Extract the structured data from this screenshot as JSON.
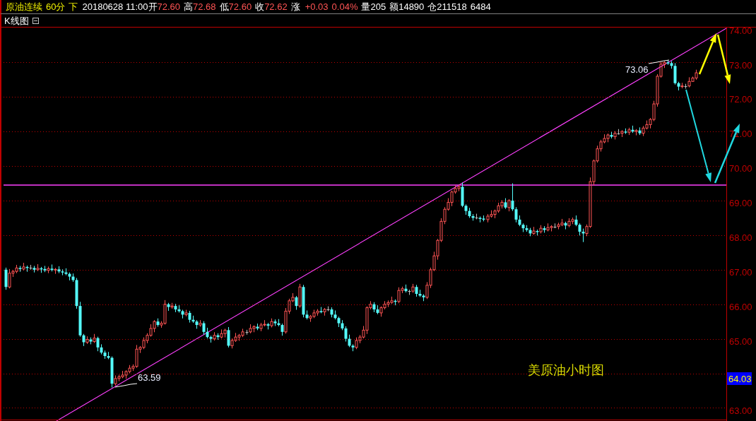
{
  "quote_bar": {
    "symbol": "原油连续",
    "period": "60分",
    "direction": "下",
    "datetime": "20180628 11:00",
    "prices": [
      {
        "label": "开",
        "value": "72.60"
      },
      {
        "label": "高",
        "value": "72.68"
      },
      {
        "label": "低",
        "value": "72.60"
      },
      {
        "label": "收",
        "value": "72.62"
      }
    ],
    "change": {
      "label": "涨",
      "value": "+0.03",
      "percent": "0.04%"
    },
    "stats": [
      "量205",
      "额14890",
      "仓211518",
      "6484"
    ]
  },
  "panel": {
    "title": "K线图"
  },
  "chart": {
    "chart_data": {
      "type": "candlestick",
      "grid": true,
      "ylim": [
        62.62,
        74.01
      ],
      "yticks": [
        {
          "value": 74,
          "label": "74.00"
        },
        {
          "value": 73,
          "label": "73.00"
        },
        {
          "value": 72,
          "label": "72.00"
        },
        {
          "value": 71,
          "label": "71.00"
        },
        {
          "value": 70,
          "label": "70.00"
        },
        {
          "value": 69,
          "label": "69.00"
        },
        {
          "value": 68,
          "label": "68.00"
        },
        {
          "value": 67,
          "label": "67.00"
        },
        {
          "value": 66,
          "label": "66.00"
        },
        {
          "value": 65,
          "label": "65.00"
        },
        {
          "value": 63,
          "label": "63.00"
        }
      ],
      "ref_lines": [
        {
          "axis": "y",
          "value": 69.45
        }
      ],
      "categories": [
        null,
        null,
        null,
        null,
        null,
        null,
        null,
        null,
        null,
        null,
        null,
        null,
        null,
        null,
        null,
        null,
        null,
        null,
        null,
        null,
        null,
        null,
        null,
        null,
        null,
        null,
        null,
        null,
        null,
        null,
        null,
        null,
        null,
        null,
        null,
        null,
        null,
        null,
        null,
        null,
        null,
        null,
        null,
        null,
        null,
        null,
        null,
        null,
        null,
        null,
        null,
        null,
        null,
        null,
        null,
        null,
        null,
        null,
        null,
        null,
        null,
        null,
        null,
        null,
        null,
        null,
        null,
        null,
        null,
        null,
        null,
        null,
        null,
        null,
        null,
        null,
        null,
        null,
        null,
        null,
        null,
        null,
        null,
        null,
        null,
        null,
        null,
        null,
        null,
        null,
        null,
        null,
        null,
        null,
        null,
        null,
        null,
        null,
        null,
        null,
        null,
        null,
        null,
        null,
        null,
        null,
        null,
        null,
        null,
        null,
        null,
        null,
        null,
        null,
        null,
        null,
        null,
        null,
        null,
        null,
        null,
        null,
        null,
        null,
        null,
        null,
        null,
        null,
        null,
        null,
        null,
        null,
        null,
        null,
        null,
        null,
        null,
        null,
        null,
        null,
        null,
        null,
        null,
        null,
        null,
        null,
        null,
        null,
        null,
        null,
        null,
        null,
        null,
        null,
        null,
        null,
        null,
        null,
        null,
        null,
        null,
        null,
        null,
        null,
        null,
        null,
        null,
        null,
        null,
        null,
        null,
        null,
        null,
        null,
        null,
        null,
        null,
        null,
        null,
        null,
        null,
        null,
        null,
        null,
        null,
        null,
        null,
        null,
        null,
        null,
        null,
        null,
        null,
        null,
        null,
        null,
        null,
        null,
        null,
        null,
        null,
        null,
        null,
        null
      ],
      "ohlc": [
        [
          67.0,
          67.06,
          66.42,
          66.5
        ],
        [
          66.5,
          67.02,
          66.46,
          66.9
        ],
        [
          66.9,
          66.99,
          66.79,
          66.95
        ],
        [
          66.95,
          67.14,
          66.9,
          67.05
        ],
        [
          67.05,
          67.11,
          66.94,
          67.02
        ],
        [
          67.02,
          67.2,
          66.98,
          67.08
        ],
        [
          67.08,
          67.12,
          66.94,
          67.05
        ],
        [
          67.05,
          67.14,
          67.0,
          67.05
        ],
        [
          67.05,
          67.11,
          66.92,
          67.0
        ],
        [
          67.0,
          67.16,
          66.96,
          67.04
        ],
        [
          67.04,
          67.08,
          66.91,
          67.02
        ],
        [
          67.02,
          67.11,
          66.93,
          66.98
        ],
        [
          66.98,
          67.09,
          66.9,
          67.03
        ],
        [
          67.03,
          67.15,
          66.95,
          66.99
        ],
        [
          66.99,
          67.05,
          66.88,
          67.01
        ],
        [
          67.01,
          67.1,
          66.9,
          66.95
        ],
        [
          66.95,
          67.01,
          66.84,
          66.92
        ],
        [
          66.92,
          67.04,
          66.84,
          66.88
        ],
        [
          66.88,
          66.92,
          66.69,
          66.8
        ],
        [
          66.8,
          66.89,
          66.65,
          66.7
        ],
        [
          66.7,
          66.76,
          65.87,
          65.95
        ],
        [
          65.95,
          66.07,
          65.06,
          65.1
        ],
        [
          65.1,
          65.14,
          64.79,
          64.9
        ],
        [
          64.9,
          65.07,
          64.85,
          64.98
        ],
        [
          64.98,
          65.04,
          64.84,
          64.92
        ],
        [
          64.92,
          65.14,
          64.88,
          65.02
        ],
        [
          65.02,
          65.06,
          64.64,
          64.75
        ],
        [
          64.75,
          64.84,
          64.55,
          64.6
        ],
        [
          64.6,
          64.66,
          64.42,
          64.5
        ],
        [
          64.5,
          64.62,
          64.41,
          64.45
        ],
        [
          64.45,
          64.49,
          63.59,
          63.7
        ],
        [
          63.7,
          63.94,
          63.65,
          63.85
        ],
        [
          63.85,
          63.96,
          63.77,
          63.9
        ],
        [
          63.9,
          64.07,
          63.86,
          63.95
        ],
        [
          63.95,
          64.09,
          63.84,
          64.05
        ],
        [
          64.05,
          64.24,
          64.0,
          64.15
        ],
        [
          64.15,
          64.26,
          64.07,
          64.2
        ],
        [
          64.2,
          64.82,
          64.16,
          64.7
        ],
        [
          64.7,
          64.79,
          64.59,
          64.75
        ],
        [
          64.75,
          65.04,
          64.7,
          64.95
        ],
        [
          64.95,
          65.16,
          64.87,
          65.1
        ],
        [
          65.1,
          65.42,
          65.06,
          65.3
        ],
        [
          65.3,
          65.54,
          65.19,
          65.5
        ],
        [
          65.5,
          65.59,
          65.35,
          65.4
        ],
        [
          65.4,
          65.51,
          65.32,
          65.45
        ],
        [
          65.45,
          66.12,
          65.41,
          66.0
        ],
        [
          66.0,
          66.04,
          65.81,
          65.92
        ],
        [
          65.92,
          66.04,
          65.87,
          65.95
        ],
        [
          65.95,
          66.01,
          65.77,
          65.85
        ],
        [
          65.85,
          65.97,
          65.76,
          65.8
        ],
        [
          65.8,
          65.84,
          65.59,
          65.7
        ],
        [
          65.7,
          65.84,
          65.65,
          65.75
        ],
        [
          65.75,
          65.81,
          65.47,
          65.55
        ],
        [
          65.55,
          65.67,
          65.46,
          65.5
        ],
        [
          65.5,
          65.54,
          65.29,
          65.4
        ],
        [
          65.4,
          65.54,
          65.35,
          65.45
        ],
        [
          65.45,
          65.51,
          65.12,
          65.2
        ],
        [
          65.2,
          65.32,
          65.01,
          65.05
        ],
        [
          65.05,
          65.09,
          64.89,
          65.0
        ],
        [
          65.0,
          65.19,
          64.95,
          65.1
        ],
        [
          65.1,
          65.16,
          64.97,
          65.05
        ],
        [
          65.05,
          65.27,
          65.01,
          65.15
        ],
        [
          65.15,
          65.29,
          65.04,
          65.25
        ],
        [
          65.25,
          65.34,
          64.75,
          64.8
        ],
        [
          64.8,
          65.01,
          64.72,
          64.95
        ],
        [
          64.95,
          65.17,
          64.91,
          65.05
        ],
        [
          65.05,
          65.14,
          64.94,
          65.1
        ],
        [
          65.1,
          65.29,
          65.05,
          65.2
        ],
        [
          65.2,
          65.26,
          65.12,
          65.2
        ],
        [
          65.2,
          65.42,
          65.16,
          65.3
        ],
        [
          65.3,
          65.39,
          65.19,
          65.35
        ],
        [
          65.35,
          65.44,
          65.25,
          65.3
        ],
        [
          65.3,
          65.46,
          65.22,
          65.4
        ],
        [
          65.4,
          65.54,
          65.36,
          65.42
        ],
        [
          65.42,
          65.46,
          65.27,
          65.38
        ],
        [
          65.38,
          65.59,
          65.33,
          65.5
        ],
        [
          65.5,
          65.56,
          65.37,
          65.45
        ],
        [
          65.45,
          65.57,
          65.36,
          65.4
        ],
        [
          65.4,
          65.44,
          65.09,
          65.2
        ],
        [
          65.2,
          65.89,
          65.15,
          65.8
        ],
        [
          65.8,
          66.16,
          65.72,
          66.1
        ],
        [
          66.1,
          66.32,
          66.06,
          66.2
        ],
        [
          66.2,
          66.24,
          65.84,
          65.95
        ],
        [
          65.95,
          66.59,
          65.9,
          66.5
        ],
        [
          66.5,
          66.56,
          65.62,
          65.7
        ],
        [
          65.7,
          65.82,
          65.56,
          65.6
        ],
        [
          65.6,
          65.69,
          65.49,
          65.65
        ],
        [
          65.65,
          65.84,
          65.6,
          65.75
        ],
        [
          65.75,
          65.86,
          65.67,
          65.8
        ],
        [
          65.8,
          65.92,
          65.74,
          65.78
        ],
        [
          65.78,
          65.89,
          65.67,
          65.85
        ],
        [
          65.85,
          65.94,
          65.8,
          65.85
        ],
        [
          65.85,
          65.91,
          65.62,
          65.7
        ],
        [
          65.7,
          65.82,
          65.56,
          65.6
        ],
        [
          65.6,
          65.64,
          65.34,
          65.45
        ],
        [
          65.45,
          65.54,
          65.25,
          65.3
        ],
        [
          65.3,
          65.36,
          64.92,
          65.0
        ],
        [
          65.0,
          65.12,
          64.76,
          64.8
        ],
        [
          64.8,
          64.84,
          64.64,
          64.75
        ],
        [
          64.75,
          65.04,
          64.7,
          64.95
        ],
        [
          64.95,
          65.11,
          64.87,
          65.05
        ],
        [
          65.05,
          65.37,
          65.01,
          65.25
        ],
        [
          65.25,
          65.94,
          65.14,
          65.9
        ],
        [
          65.9,
          66.09,
          65.85,
          66.0
        ],
        [
          66.0,
          66.06,
          65.77,
          65.85
        ],
        [
          65.85,
          65.97,
          65.71,
          65.75
        ],
        [
          65.75,
          65.94,
          65.64,
          65.9
        ],
        [
          65.9,
          66.09,
          65.85,
          66.0
        ],
        [
          66.0,
          66.11,
          65.92,
          66.05
        ],
        [
          66.05,
          66.22,
          66.01,
          66.1
        ],
        [
          66.1,
          66.14,
          65.97,
          66.08
        ],
        [
          66.08,
          66.49,
          66.03,
          66.4
        ],
        [
          66.4,
          66.51,
          66.32,
          66.45
        ],
        [
          66.45,
          66.57,
          66.34,
          66.38
        ],
        [
          66.38,
          66.42,
          66.27,
          66.38
        ],
        [
          66.38,
          66.59,
          66.33,
          66.5
        ],
        [
          66.5,
          66.56,
          66.22,
          66.3
        ],
        [
          66.3,
          66.42,
          66.21,
          66.25
        ],
        [
          66.25,
          66.29,
          66.09,
          66.2
        ],
        [
          66.2,
          66.64,
          66.15,
          66.55
        ],
        [
          66.55,
          67.06,
          66.47,
          67.0
        ],
        [
          67.0,
          67.52,
          66.96,
          67.4
        ],
        [
          67.4,
          67.89,
          67.29,
          67.85
        ],
        [
          67.85,
          68.49,
          67.8,
          68.4
        ],
        [
          68.4,
          68.81,
          68.32,
          68.75
        ],
        [
          68.75,
          69.07,
          68.71,
          68.95
        ],
        [
          68.95,
          69.29,
          68.84,
          69.25
        ],
        [
          69.25,
          69.44,
          69.2,
          69.35
        ],
        [
          69.35,
          69.46,
          69.27,
          69.4
        ],
        [
          69.4,
          69.52,
          68.81,
          68.85
        ],
        [
          68.85,
          68.89,
          68.59,
          68.7
        ],
        [
          68.7,
          68.79,
          68.5,
          68.55
        ],
        [
          68.55,
          68.61,
          68.42,
          68.5
        ],
        [
          68.5,
          68.62,
          68.46,
          68.5
        ],
        [
          68.5,
          68.54,
          68.37,
          68.48
        ],
        [
          68.48,
          68.57,
          68.4,
          68.45
        ],
        [
          68.45,
          68.61,
          68.37,
          68.55
        ],
        [
          68.55,
          68.72,
          68.51,
          68.6
        ],
        [
          68.6,
          68.74,
          68.49,
          68.7
        ],
        [
          68.7,
          68.94,
          68.65,
          68.85
        ],
        [
          68.85,
          69.01,
          68.77,
          68.95
        ],
        [
          68.95,
          69.07,
          68.76,
          68.8
        ],
        [
          68.8,
          69.04,
          68.69,
          69.0
        ],
        [
          69.0,
          69.5,
          68.7,
          68.75
        ],
        [
          68.75,
          68.81,
          68.37,
          68.45
        ],
        [
          68.45,
          68.57,
          68.26,
          68.3
        ],
        [
          68.3,
          68.34,
          68.09,
          68.2
        ],
        [
          68.2,
          68.29,
          68.1,
          68.15
        ],
        [
          68.15,
          68.21,
          67.97,
          68.05
        ],
        [
          68.05,
          68.24,
          68.01,
          68.12
        ],
        [
          68.12,
          68.16,
          67.99,
          68.1
        ],
        [
          68.1,
          68.29,
          68.05,
          68.2
        ],
        [
          68.2,
          68.26,
          68.07,
          68.15
        ],
        [
          68.15,
          68.34,
          68.11,
          68.22
        ],
        [
          68.22,
          68.29,
          68.11,
          68.25
        ],
        [
          68.25,
          68.34,
          68.2,
          68.25
        ],
        [
          68.25,
          68.36,
          68.17,
          68.3
        ],
        [
          68.3,
          68.47,
          68.26,
          68.35
        ],
        [
          68.35,
          68.39,
          68.17,
          68.28
        ],
        [
          68.28,
          68.49,
          68.23,
          68.4
        ],
        [
          68.4,
          68.51,
          68.32,
          68.45
        ],
        [
          68.45,
          68.57,
          68.26,
          68.3
        ],
        [
          68.3,
          68.34,
          67.99,
          68.1
        ],
        [
          68.1,
          68.19,
          67.8,
          68.05
        ],
        [
          68.05,
          68.31,
          67.97,
          68.25
        ],
        [
          68.25,
          69.67,
          68.21,
          69.55
        ],
        [
          69.55,
          70.19,
          69.44,
          70.15
        ],
        [
          70.15,
          70.59,
          70.1,
          70.5
        ],
        [
          70.5,
          70.76,
          70.42,
          70.7
        ],
        [
          70.7,
          70.92,
          70.66,
          70.8
        ],
        [
          70.8,
          70.94,
          70.69,
          70.9
        ],
        [
          70.9,
          70.99,
          70.8,
          70.85
        ],
        [
          70.85,
          71.01,
          70.77,
          70.95
        ],
        [
          70.95,
          71.07,
          70.91,
          70.95
        ],
        [
          70.95,
          71.04,
          70.84,
          71.0
        ],
        [
          71.0,
          71.09,
          70.93,
          70.98
        ],
        [
          70.98,
          71.11,
          70.9,
          71.05
        ],
        [
          71.05,
          71.17,
          70.96,
          71.0
        ],
        [
          71.0,
          71.07,
          70.89,
          71.03
        ],
        [
          71.03,
          71.12,
          70.9,
          70.95
        ],
        [
          70.95,
          71.16,
          70.87,
          71.1
        ],
        [
          71.1,
          71.32,
          71.06,
          71.2
        ],
        [
          71.2,
          71.39,
          71.09,
          71.35
        ],
        [
          71.35,
          71.89,
          71.3,
          71.8
        ],
        [
          71.8,
          72.66,
          71.72,
          72.6
        ],
        [
          72.6,
          73.02,
          72.56,
          72.95
        ],
        [
          72.95,
          73.04,
          72.84,
          73.0
        ],
        [
          73.0,
          73.06,
          72.93,
          72.98
        ],
        [
          72.98,
          73.04,
          72.82,
          72.9
        ],
        [
          72.9,
          72.98,
          72.36,
          72.4
        ],
        [
          72.4,
          72.44,
          72.19,
          72.3
        ],
        [
          72.3,
          72.41,
          72.25,
          72.32
        ],
        [
          72.32,
          72.38,
          72.24,
          72.32
        ],
        [
          72.32,
          72.57,
          72.28,
          72.45
        ],
        [
          72.45,
          72.59,
          72.44,
          72.55
        ],
        [
          72.55,
          72.79,
          72.5,
          72.7
        ],
        null,
        null,
        null,
        null,
        null,
        null,
        null,
        null
      ]
    },
    "current_price": "64.03",
    "high_label": "73.06",
    "low_label": "63.59",
    "caption": "美原油小时图"
  }
}
